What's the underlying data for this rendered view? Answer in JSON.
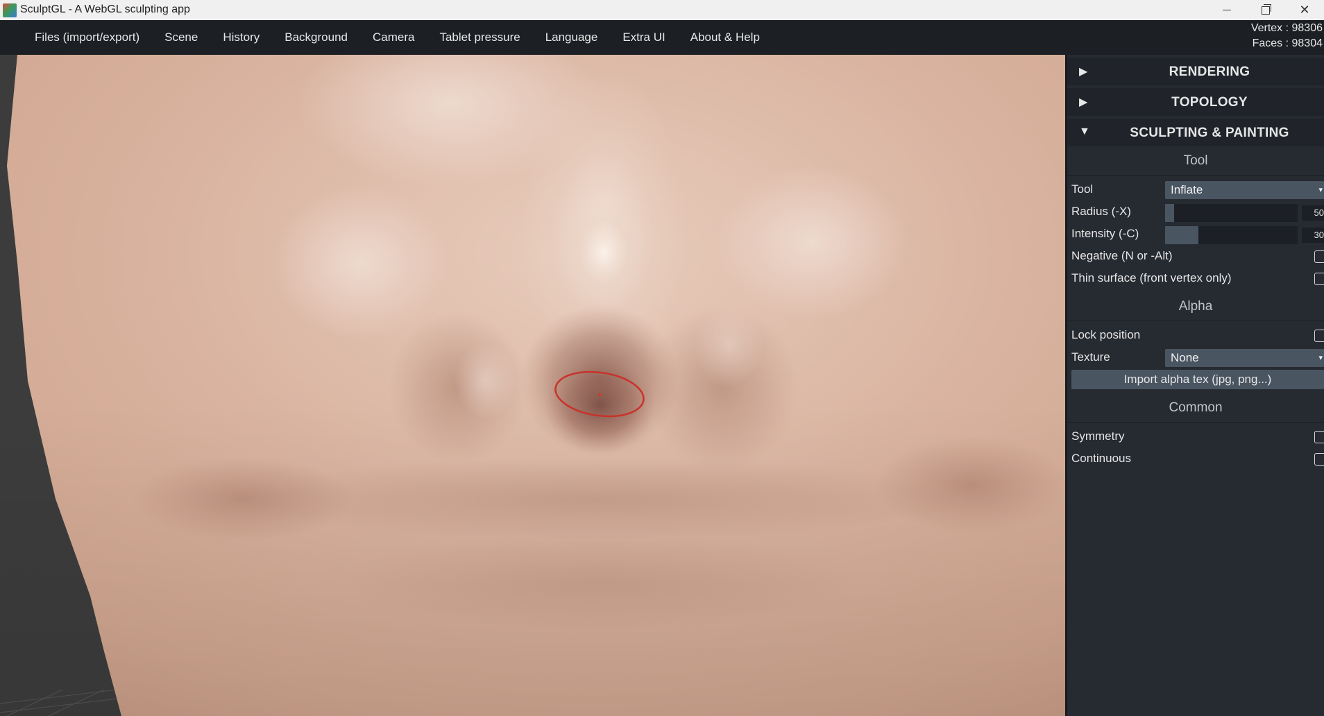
{
  "window": {
    "title": "SculptGL - A WebGL sculpting app",
    "icons": {
      "app": "sculptgl-app-icon",
      "minimize": "minimize-icon",
      "maximize": "restore-icon",
      "close": "close-icon"
    },
    "close_glyph": "✕"
  },
  "menu": {
    "items": [
      {
        "label": "Files (import/export)"
      },
      {
        "label": "Scene"
      },
      {
        "label": "History"
      },
      {
        "label": "Background"
      },
      {
        "label": "Camera"
      },
      {
        "label": "Tablet pressure"
      },
      {
        "label": "Language"
      },
      {
        "label": "Extra UI"
      },
      {
        "label": "About & Help"
      }
    ]
  },
  "stats": {
    "vertex": "Vertex : 98306",
    "faces": "Faces : 98304"
  },
  "panel": {
    "sections": [
      {
        "label": "RENDERING",
        "arrow": "▶",
        "expanded": false
      },
      {
        "label": "TOPOLOGY",
        "arrow": "▶",
        "expanded": false
      },
      {
        "label": "SCULPTING & PAINTING",
        "arrow": "▼",
        "expanded": true
      }
    ],
    "tool_group": {
      "title": "Tool",
      "tool_label": "Tool",
      "tool_value": "Inflate",
      "radius_label": "Radius (-X)",
      "radius_value": "50",
      "radius_fraction": 0.07,
      "intensity_label": "Intensity (-C)",
      "intensity_value": "30",
      "intensity_fraction": 0.25,
      "negative_label": "Negative (N or -Alt)",
      "negative_checked": false,
      "thin_label": "Thin surface (front vertex only)",
      "thin_checked": false
    },
    "alpha_group": {
      "title": "Alpha",
      "lock_label": "Lock position",
      "lock_checked": false,
      "texture_label": "Texture",
      "texture_value": "None",
      "import_label": "Import alpha tex (jpg, png...)"
    },
    "common_group": {
      "title": "Common",
      "symmetry_label": "Symmetry",
      "symmetry_checked": false,
      "continuous_label": "Continuous",
      "continuous_checked": false
    },
    "caret": "▾"
  },
  "colors": {
    "panel_bg": "#262a31",
    "menubar_bg": "#1c1f24",
    "mesh_skin": "#d9b4a0",
    "brush_ring": "#c8322a"
  }
}
